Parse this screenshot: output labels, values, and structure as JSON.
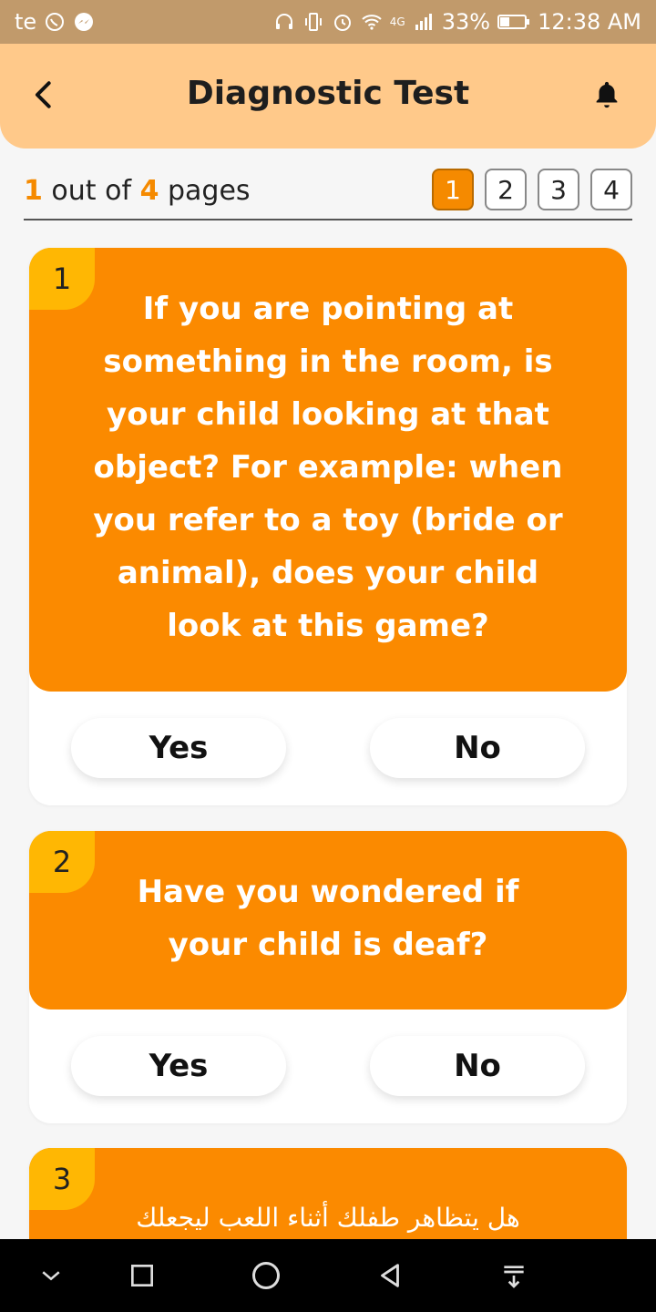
{
  "status_bar": {
    "carrier": "te",
    "network": "4G",
    "battery": "33%",
    "time": "12:38 AM"
  },
  "header": {
    "title": "Diagnostic Test",
    "back_icon": "chevron-left-icon",
    "bell_icon": "bell-icon"
  },
  "pager": {
    "current": "1",
    "out_of": "out of",
    "total": "4",
    "suffix": "pages",
    "pages": [
      "1",
      "2",
      "3",
      "4"
    ]
  },
  "questions": [
    {
      "number": "1",
      "text": "If you are pointing at something in the room, is your child looking at that object? For example: when you refer to a toy (bride or animal), does your child look at this game?",
      "yes_label": "Yes",
      "no_label": "No"
    },
    {
      "number": "2",
      "text": "Have you wondered if your child is deaf?",
      "yes_label": "Yes",
      "no_label": "No"
    },
    {
      "number": "3",
      "text": "هل يتظاهر طفلك أثناء اللعب ليجعلك"
    }
  ],
  "colors": {
    "accent": "#fb8a00",
    "badge": "#ffb703",
    "header_bg": "#ffc98a",
    "status_bar_bg": "#c19a6b"
  }
}
